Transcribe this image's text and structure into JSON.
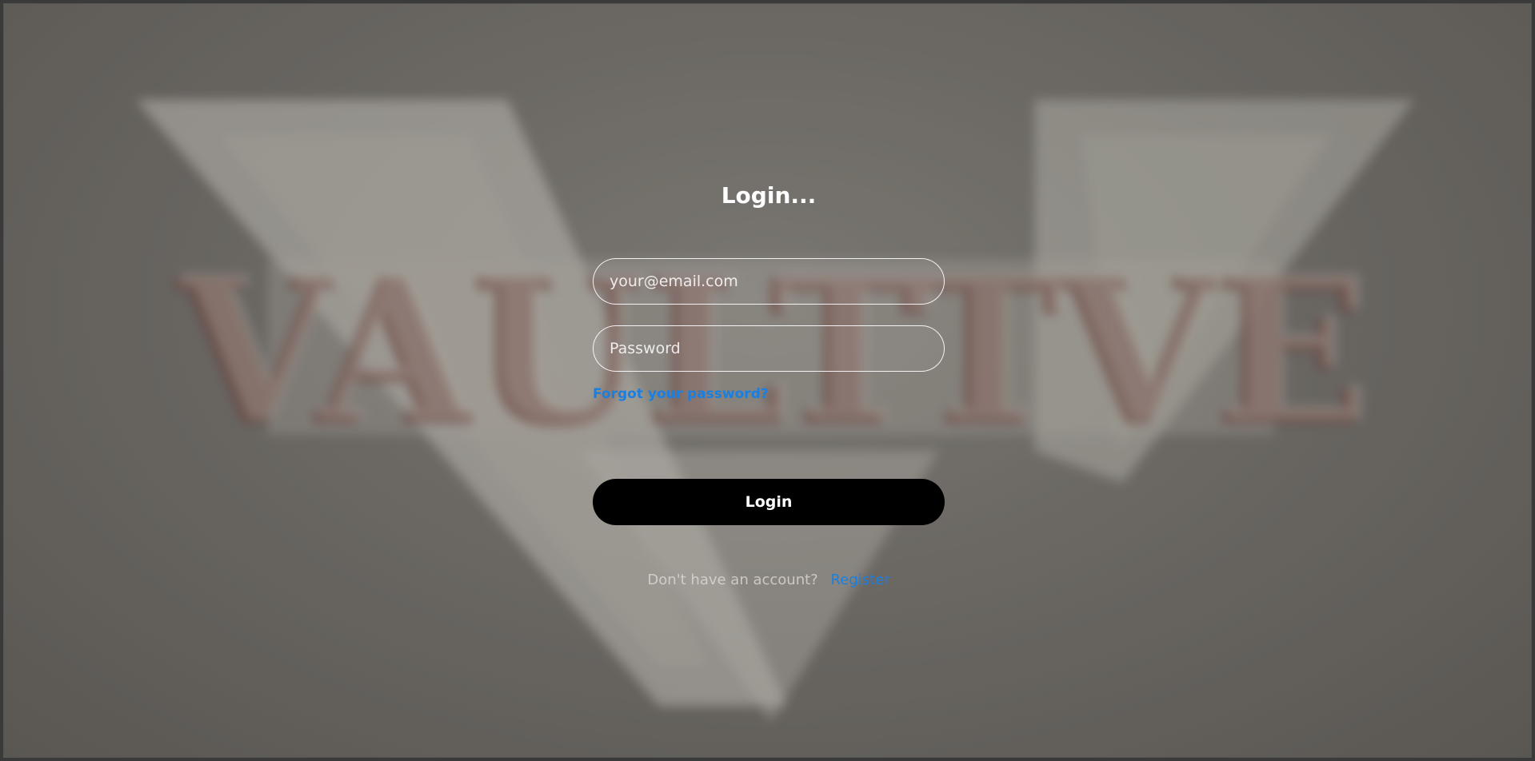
{
  "background": {
    "logo_text": "VAULTTVE",
    "colors": {
      "surface": "#8d8984",
      "logo_face": "#d8d4cc",
      "logo_inlay": "#6e2a2a"
    }
  },
  "login": {
    "title": "Login...",
    "email_placeholder": "your@email.com",
    "password_placeholder": "Password",
    "forgot_label": "Forgot your password?",
    "submit_label": "Login",
    "register_prompt": "Don't have an account?",
    "register_label": "Register"
  },
  "colors": {
    "accent": "#1a7fe0",
    "button_bg": "#000000",
    "text": "#ffffff"
  }
}
